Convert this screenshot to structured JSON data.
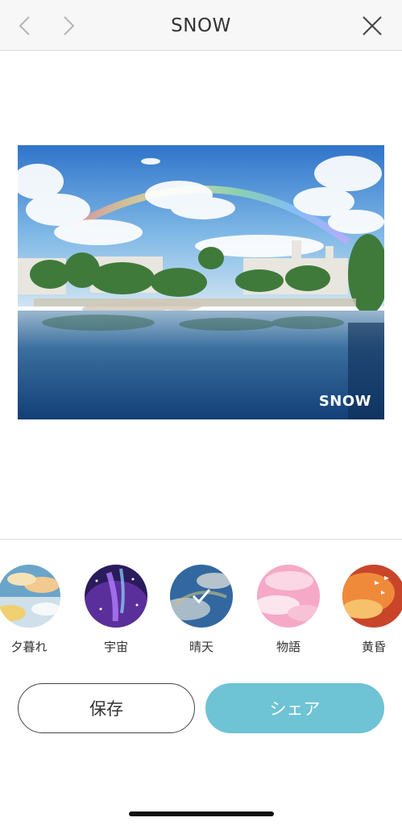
{
  "header": {
    "title": "SNOW",
    "back_icon": "chevron-left-icon",
    "forward_icon": "chevron-right-icon",
    "close_icon": "close-icon"
  },
  "photo": {
    "watermark": "SNOW"
  },
  "filters": [
    {
      "label": "夕暮れ",
      "selected": false
    },
    {
      "label": "宇宙",
      "selected": false
    },
    {
      "label": "晴天",
      "selected": true
    },
    {
      "label": "物語",
      "selected": false
    },
    {
      "label": "黄昏",
      "selected": false
    }
  ],
  "actions": {
    "save_label": "保存",
    "share_label": "シェア"
  },
  "colors": {
    "accent": "#6ec3d4",
    "header_bg": "#f7f7f7"
  }
}
